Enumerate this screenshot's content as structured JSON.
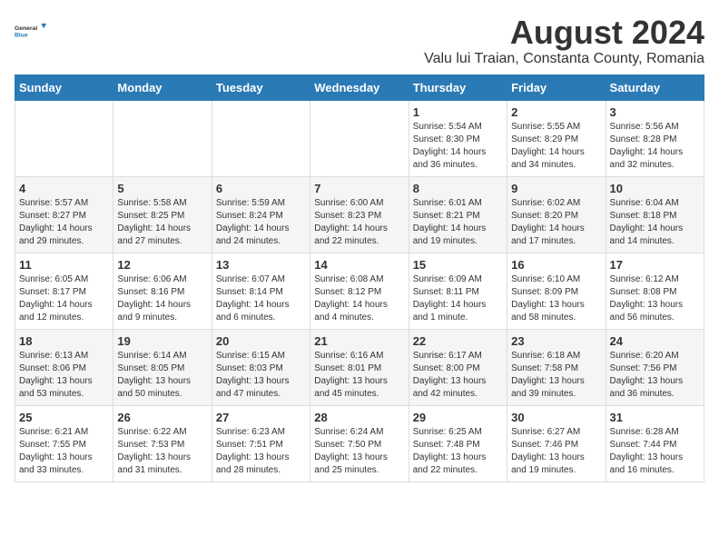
{
  "header": {
    "logo_general": "General",
    "logo_blue": "Blue",
    "title": "August 2024",
    "subtitle": "Valu lui Traian, Constanta County, Romania"
  },
  "days_of_week": [
    "Sunday",
    "Monday",
    "Tuesday",
    "Wednesday",
    "Thursday",
    "Friday",
    "Saturday"
  ],
  "weeks": [
    [
      {
        "day": "",
        "info": ""
      },
      {
        "day": "",
        "info": ""
      },
      {
        "day": "",
        "info": ""
      },
      {
        "day": "",
        "info": ""
      },
      {
        "day": "1",
        "info": "Sunrise: 5:54 AM\nSunset: 8:30 PM\nDaylight: 14 hours and 36 minutes."
      },
      {
        "day": "2",
        "info": "Sunrise: 5:55 AM\nSunset: 8:29 PM\nDaylight: 14 hours and 34 minutes."
      },
      {
        "day": "3",
        "info": "Sunrise: 5:56 AM\nSunset: 8:28 PM\nDaylight: 14 hours and 32 minutes."
      }
    ],
    [
      {
        "day": "4",
        "info": "Sunrise: 5:57 AM\nSunset: 8:27 PM\nDaylight: 14 hours and 29 minutes."
      },
      {
        "day": "5",
        "info": "Sunrise: 5:58 AM\nSunset: 8:25 PM\nDaylight: 14 hours and 27 minutes."
      },
      {
        "day": "6",
        "info": "Sunrise: 5:59 AM\nSunset: 8:24 PM\nDaylight: 14 hours and 24 minutes."
      },
      {
        "day": "7",
        "info": "Sunrise: 6:00 AM\nSunset: 8:23 PM\nDaylight: 14 hours and 22 minutes."
      },
      {
        "day": "8",
        "info": "Sunrise: 6:01 AM\nSunset: 8:21 PM\nDaylight: 14 hours and 19 minutes."
      },
      {
        "day": "9",
        "info": "Sunrise: 6:02 AM\nSunset: 8:20 PM\nDaylight: 14 hours and 17 minutes."
      },
      {
        "day": "10",
        "info": "Sunrise: 6:04 AM\nSunset: 8:18 PM\nDaylight: 14 hours and 14 minutes."
      }
    ],
    [
      {
        "day": "11",
        "info": "Sunrise: 6:05 AM\nSunset: 8:17 PM\nDaylight: 14 hours and 12 minutes."
      },
      {
        "day": "12",
        "info": "Sunrise: 6:06 AM\nSunset: 8:16 PM\nDaylight: 14 hours and 9 minutes."
      },
      {
        "day": "13",
        "info": "Sunrise: 6:07 AM\nSunset: 8:14 PM\nDaylight: 14 hours and 6 minutes."
      },
      {
        "day": "14",
        "info": "Sunrise: 6:08 AM\nSunset: 8:12 PM\nDaylight: 14 hours and 4 minutes."
      },
      {
        "day": "15",
        "info": "Sunrise: 6:09 AM\nSunset: 8:11 PM\nDaylight: 14 hours and 1 minute."
      },
      {
        "day": "16",
        "info": "Sunrise: 6:10 AM\nSunset: 8:09 PM\nDaylight: 13 hours and 58 minutes."
      },
      {
        "day": "17",
        "info": "Sunrise: 6:12 AM\nSunset: 8:08 PM\nDaylight: 13 hours and 56 minutes."
      }
    ],
    [
      {
        "day": "18",
        "info": "Sunrise: 6:13 AM\nSunset: 8:06 PM\nDaylight: 13 hours and 53 minutes."
      },
      {
        "day": "19",
        "info": "Sunrise: 6:14 AM\nSunset: 8:05 PM\nDaylight: 13 hours and 50 minutes."
      },
      {
        "day": "20",
        "info": "Sunrise: 6:15 AM\nSunset: 8:03 PM\nDaylight: 13 hours and 47 minutes."
      },
      {
        "day": "21",
        "info": "Sunrise: 6:16 AM\nSunset: 8:01 PM\nDaylight: 13 hours and 45 minutes."
      },
      {
        "day": "22",
        "info": "Sunrise: 6:17 AM\nSunset: 8:00 PM\nDaylight: 13 hours and 42 minutes."
      },
      {
        "day": "23",
        "info": "Sunrise: 6:18 AM\nSunset: 7:58 PM\nDaylight: 13 hours and 39 minutes."
      },
      {
        "day": "24",
        "info": "Sunrise: 6:20 AM\nSunset: 7:56 PM\nDaylight: 13 hours and 36 minutes."
      }
    ],
    [
      {
        "day": "25",
        "info": "Sunrise: 6:21 AM\nSunset: 7:55 PM\nDaylight: 13 hours and 33 minutes."
      },
      {
        "day": "26",
        "info": "Sunrise: 6:22 AM\nSunset: 7:53 PM\nDaylight: 13 hours and 31 minutes."
      },
      {
        "day": "27",
        "info": "Sunrise: 6:23 AM\nSunset: 7:51 PM\nDaylight: 13 hours and 28 minutes."
      },
      {
        "day": "28",
        "info": "Sunrise: 6:24 AM\nSunset: 7:50 PM\nDaylight: 13 hours and 25 minutes."
      },
      {
        "day": "29",
        "info": "Sunrise: 6:25 AM\nSunset: 7:48 PM\nDaylight: 13 hours and 22 minutes."
      },
      {
        "day": "30",
        "info": "Sunrise: 6:27 AM\nSunset: 7:46 PM\nDaylight: 13 hours and 19 minutes."
      },
      {
        "day": "31",
        "info": "Sunrise: 6:28 AM\nSunset: 7:44 PM\nDaylight: 13 hours and 16 minutes."
      }
    ]
  ]
}
